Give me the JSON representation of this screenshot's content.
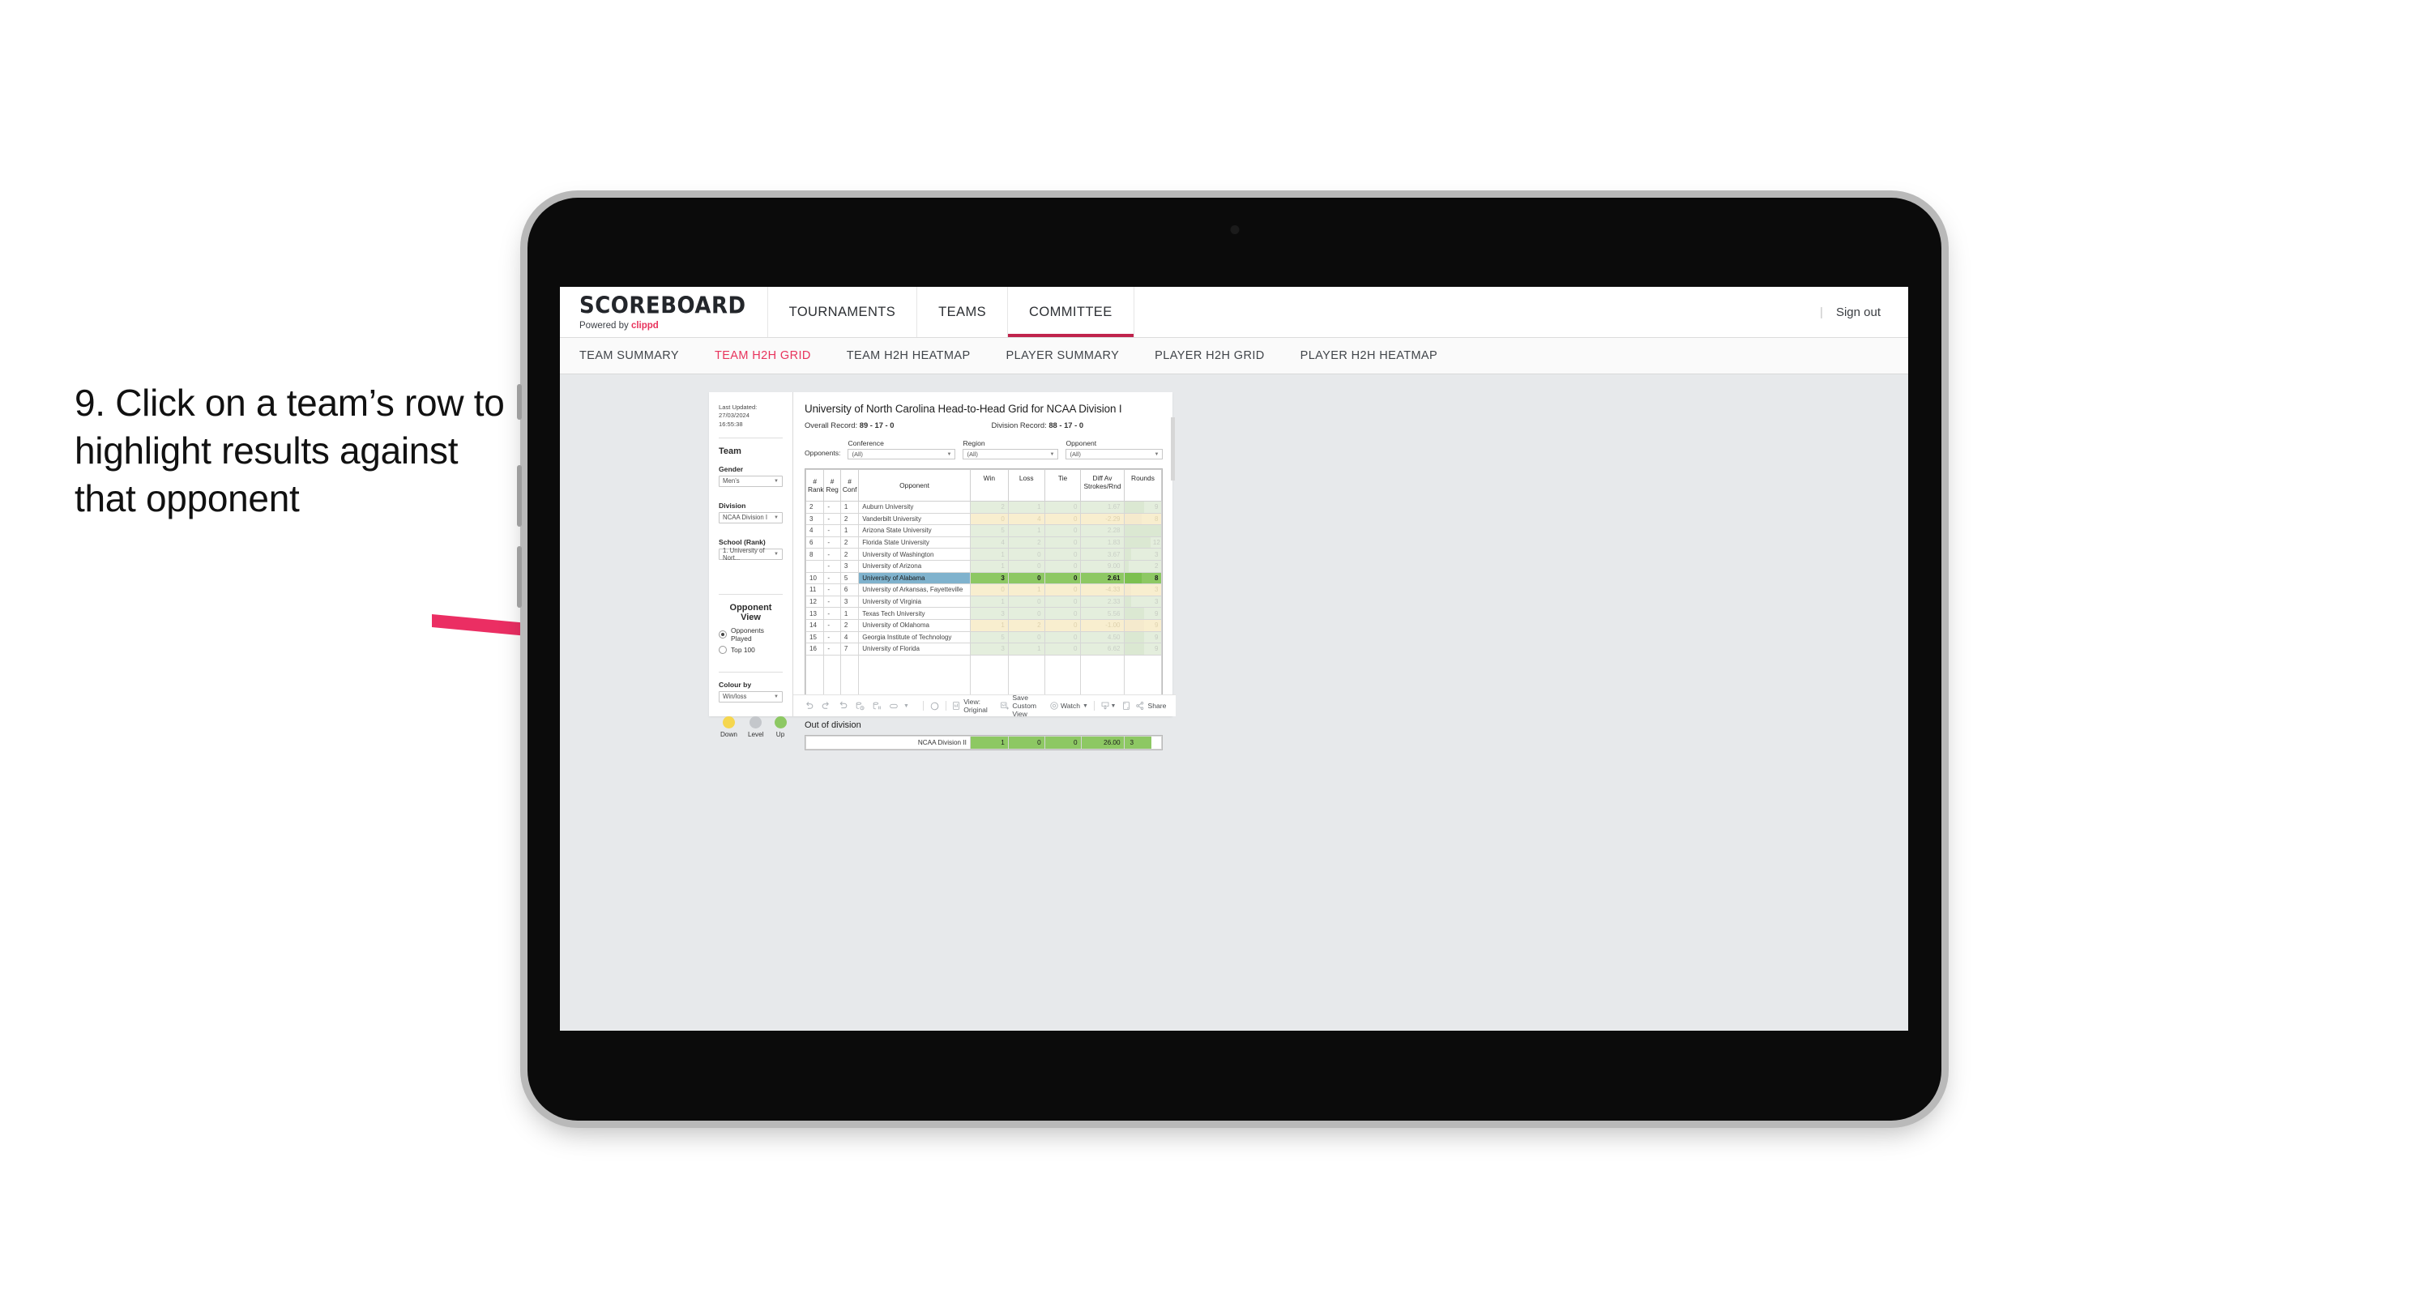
{
  "instruction": {
    "text": "9. Click on a team’s row to highlight results against that opponent"
  },
  "app": {
    "logo": {
      "brand": "SCOREBOARD",
      "powered_prefix": "Powered by ",
      "powered_brand": "clippd"
    },
    "top_nav": [
      {
        "label": "TOURNAMENTS",
        "active": false
      },
      {
        "label": "TEAMS",
        "active": false
      },
      {
        "label": "COMMITTEE",
        "active": true
      }
    ],
    "top_right": {
      "separator": "|",
      "sign_out": "Sign out"
    },
    "sub_tabs": [
      {
        "label": "TEAM SUMMARY",
        "active": false
      },
      {
        "label": "TEAM H2H GRID",
        "active": true
      },
      {
        "label": "TEAM H2H HEATMAP",
        "active": false
      },
      {
        "label": "PLAYER SUMMARY",
        "active": false
      },
      {
        "label": "PLAYER H2H GRID",
        "active": false
      },
      {
        "label": "PLAYER H2H HEATMAP",
        "active": false
      }
    ]
  },
  "sidebar": {
    "last_updated_line1": "Last Updated: 27/03/2024",
    "last_updated_line2": "16:55:38",
    "team_heading": "Team",
    "gender_label": "Gender",
    "gender_value": "Men’s",
    "division_label": "Division",
    "division_value": "NCAA Division I",
    "school_label": "School (Rank)",
    "school_value": "1. University of Nort...",
    "opponent_view_heading": "Opponent View",
    "opponent_view_options": [
      {
        "label": "Opponents Played",
        "selected": true
      },
      {
        "label": "Top 100",
        "selected": false
      }
    ],
    "colour_by_label": "Colour by",
    "colour_by_value": "Win/loss",
    "legend": [
      {
        "label": "Down",
        "color": "#f5d64e"
      },
      {
        "label": "Level",
        "color": "#c4c7cb"
      },
      {
        "label": "Up",
        "color": "#8dc863"
      }
    ]
  },
  "view": {
    "title": "University of North Carolina Head-to-Head Grid for NCAA Division I",
    "overall_record_label": "Overall Record: ",
    "overall_record_value": "89 - 17 - 0",
    "division_record_label": "Division Record: ",
    "division_record_value": "88 - 17 - 0",
    "opponents_label": "Opponents:",
    "filters": [
      {
        "label": "Conference",
        "value": "(All)"
      },
      {
        "label": "Region",
        "value": "(All)"
      },
      {
        "label": "Opponent",
        "value": "(All)"
      }
    ]
  },
  "chart_data": {
    "type": "table",
    "title": "University of North Carolina Head-to-Head Grid for NCAA Division I",
    "columns": [
      "# Rank",
      "# Reg",
      "# Conf",
      "Opponent",
      "Win",
      "Loss",
      "Tie",
      "Diff Av Strokes/Rnd",
      "Rounds"
    ],
    "column_headers_multiline": [
      {
        "line1": "#",
        "line2": "Rank"
      },
      {
        "line1": "#",
        "line2": "Reg"
      },
      {
        "line1": "#",
        "line2": "Conf"
      },
      {
        "line1": "",
        "line2": "Opponent"
      },
      {
        "line1": "Win",
        "line2": ""
      },
      {
        "line1": "Loss",
        "line2": ""
      },
      {
        "line1": "Tie",
        "line2": ""
      },
      {
        "line1": "Diff Av",
        "line2": "Strokes/Rnd"
      },
      {
        "line1": "Rounds",
        "line2": ""
      }
    ],
    "rounds_max": 17,
    "rows": [
      {
        "rank": "2",
        "reg": "-",
        "conf": "1",
        "opponent": "Auburn University",
        "win": "2",
        "loss": "1",
        "tie": "0",
        "diff": "1.67",
        "rounds": 9,
        "state": "win",
        "selected": false
      },
      {
        "rank": "3",
        "reg": "-",
        "conf": "2",
        "opponent": "Vanderbilt University",
        "win": "0",
        "loss": "4",
        "tie": "0",
        "diff": "-2.29",
        "rounds": 8,
        "state": "loss",
        "selected": false
      },
      {
        "rank": "4",
        "reg": "-",
        "conf": "1",
        "opponent": "Arizona State University",
        "win": "5",
        "loss": "1",
        "tie": "0",
        "diff": "2.28",
        "rounds": 17,
        "state": "win",
        "selected": false
      },
      {
        "rank": "6",
        "reg": "-",
        "conf": "2",
        "opponent": "Florida State University",
        "win": "4",
        "loss": "2",
        "tie": "0",
        "diff": "1.83",
        "rounds": 12,
        "state": "win",
        "selected": false
      },
      {
        "rank": "8",
        "reg": "-",
        "conf": "2",
        "opponent": "University of Washington",
        "win": "1",
        "loss": "0",
        "tie": "0",
        "diff": "3.67",
        "rounds": 3,
        "state": "win",
        "selected": false
      },
      {
        "rank": "",
        "reg": "-",
        "conf": "3",
        "opponent": "University of Arizona",
        "win": "1",
        "loss": "0",
        "tie": "0",
        "diff": "9.00",
        "rounds": 2,
        "state": "win",
        "selected": false
      },
      {
        "rank": "10",
        "reg": "-",
        "conf": "5",
        "opponent": "University of Alabama",
        "win": "3",
        "loss": "0",
        "tie": "0",
        "diff": "2.61",
        "rounds": 8,
        "state": "selected",
        "selected": true
      },
      {
        "rank": "11",
        "reg": "-",
        "conf": "6",
        "opponent": "University of Arkansas, Fayetteville",
        "win": "0",
        "loss": "1",
        "tie": "0",
        "diff": "-4.33",
        "rounds": 3,
        "state": "loss",
        "selected": false
      },
      {
        "rank": "12",
        "reg": "-",
        "conf": "3",
        "opponent": "University of Virginia",
        "win": "1",
        "loss": "0",
        "tie": "0",
        "diff": "2.33",
        "rounds": 3,
        "state": "win",
        "selected": false
      },
      {
        "rank": "13",
        "reg": "-",
        "conf": "1",
        "opponent": "Texas Tech University",
        "win": "3",
        "loss": "0",
        "tie": "0",
        "diff": "5.56",
        "rounds": 9,
        "state": "win",
        "selected": false
      },
      {
        "rank": "14",
        "reg": "-",
        "conf": "2",
        "opponent": "University of Oklahoma",
        "win": "1",
        "loss": "2",
        "tie": "0",
        "diff": "-1.00",
        "rounds": 9,
        "state": "loss",
        "selected": false
      },
      {
        "rank": "15",
        "reg": "-",
        "conf": "4",
        "opponent": "Georgia Institute of Technology",
        "win": "5",
        "loss": "0",
        "tie": "0",
        "diff": "4.50",
        "rounds": 9,
        "state": "win",
        "selected": false
      },
      {
        "rank": "16",
        "reg": "-",
        "conf": "7",
        "opponent": "University of Florida",
        "win": "3",
        "loss": "1",
        "tie": "0",
        "diff": "6.62",
        "rounds": 9,
        "state": "win",
        "selected": false
      }
    ]
  },
  "out_of_division": {
    "title": "Out of division",
    "row": {
      "label": "NCAA Division II",
      "win": "1",
      "loss": "0",
      "tie": "0",
      "diff": "26.00",
      "rounds": "3"
    }
  },
  "toolbar": {
    "view_label": "View: Original",
    "save_custom_view": "Save Custom View",
    "watch": "Watch",
    "share": "Share"
  }
}
